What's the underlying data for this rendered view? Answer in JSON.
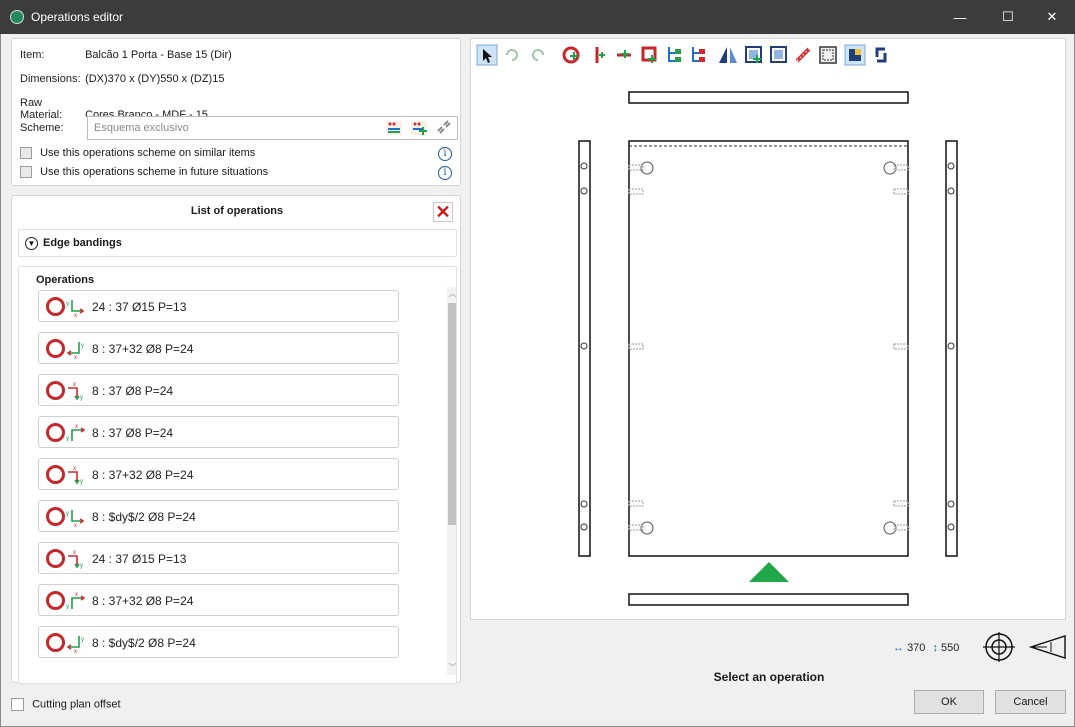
{
  "window": {
    "title": "Operations editor"
  },
  "info": {
    "item_label": "Item:",
    "item_value": "Balcão 1 Porta - Base 15 (Dir)",
    "dimensions_label": "Dimensions:",
    "dimensions_value": "(DX)370 x (DY)550 x (DZ)15",
    "material_label": "Raw Material:",
    "material_value": "Cores.Branco - MDF - 15",
    "scheme_label": "Scheme:",
    "scheme_placeholder": "Esquema exclusivo",
    "chk_similar": "Use this operations scheme on similar items",
    "chk_future": "Use this operations scheme in future situations"
  },
  "ops_panel": {
    "title": "List of operations",
    "edge_bandings": "Edge bandings",
    "operations_header": "Operations",
    "items": [
      {
        "text": "24 : 37 Ø15 P=13",
        "axis": "yx-right"
      },
      {
        "text": "8 : 37+32 Ø8 P=24",
        "axis": "yx-left"
      },
      {
        "text": "8 : 37 Ø8 P=24",
        "axis": "xy-left-down"
      },
      {
        "text": "8 : 37 Ø8 P=24",
        "axis": "xy-right-up"
      },
      {
        "text": "8 : 37+32 Ø8 P=24",
        "axis": "xy-left-down"
      },
      {
        "text": "8 : $dy$/2 Ø8 P=24",
        "axis": "yx-right"
      },
      {
        "text": "24 : 37 Ø15 P=13",
        "axis": "xy-left-down"
      },
      {
        "text": "8 : 37+32 Ø8 P=24",
        "axis": "xy-right-up"
      },
      {
        "text": "8 : $dy$/2 Ø8 P=24",
        "axis": "yx-left"
      }
    ]
  },
  "footer": {
    "cutting_offset": "Cutting plan offset",
    "status": "Select an operation",
    "ok": "OK",
    "cancel": "Cancel",
    "dim_x": "370",
    "dim_y": "550"
  },
  "colors": {
    "drill": "#c8262a",
    "axis_green": "#1ea34a",
    "axis_red": "#d9262c",
    "triangle": "#22a64a",
    "select_blue": "#1f6fd1"
  }
}
